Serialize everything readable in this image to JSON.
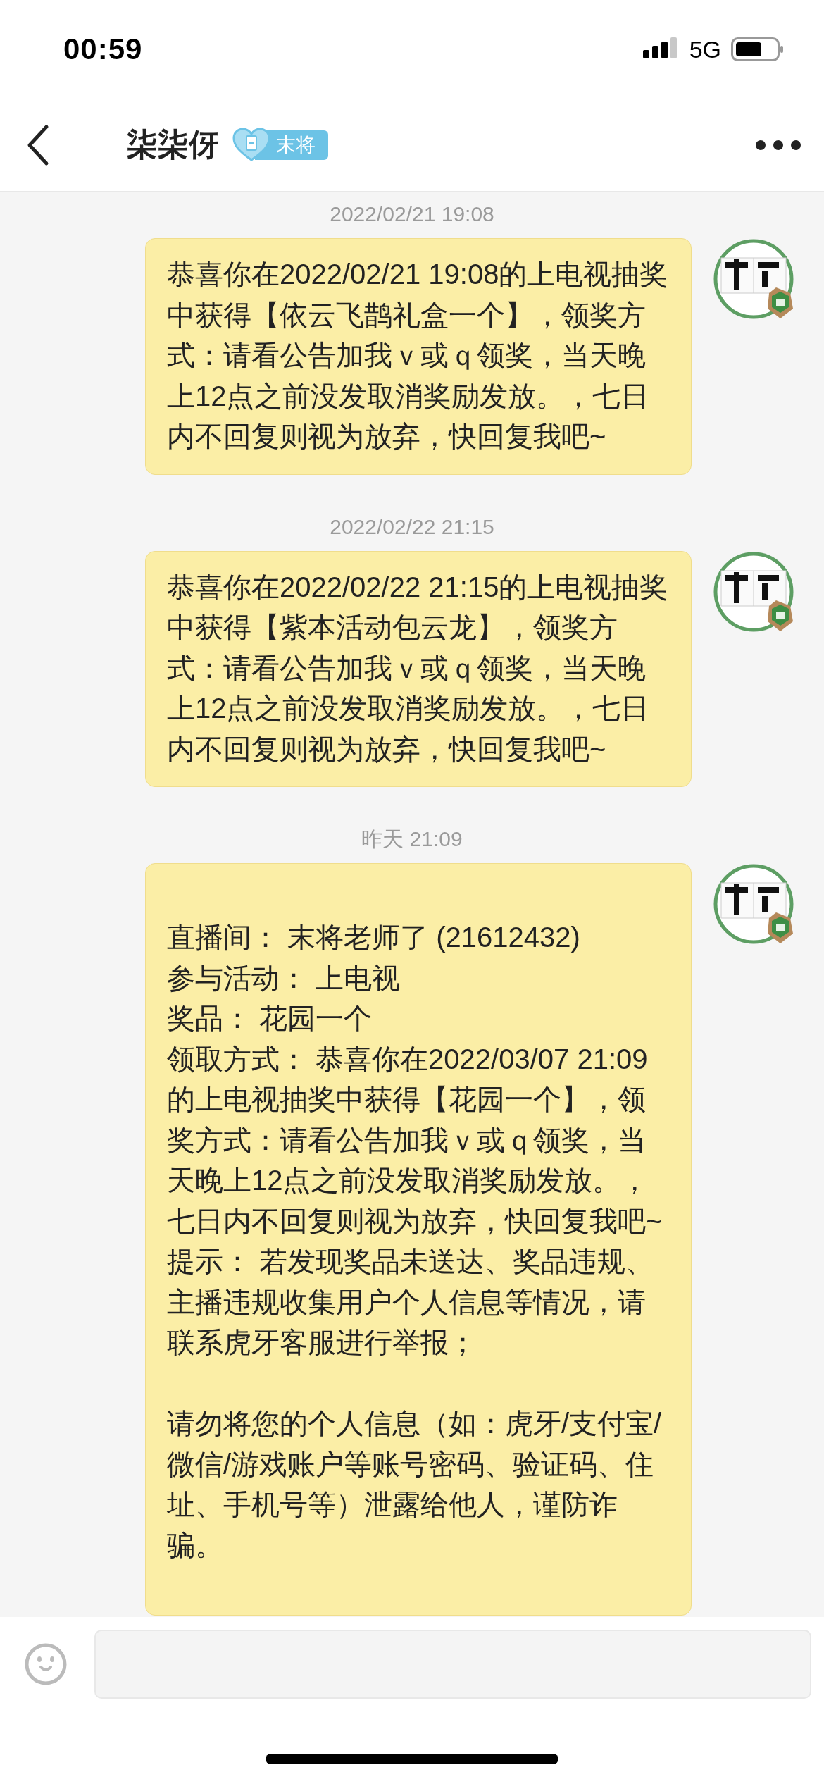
{
  "status_bar": {
    "time": "00:59",
    "network": "5G"
  },
  "header": {
    "title": "柒柒伢",
    "badge": "末将"
  },
  "messages": [
    {
      "timestamp": "2022/02/21 19:08",
      "kind": "text",
      "text": "恭喜你在2022/02/21 19:08的上电视抽奖中获得【依云飞鹊礼盒一个】，领奖方式：请看公告加我ｖ或ｑ领奖，当天晚上12点之前没发取消奖励发放。，七日内不回复则视为放弃，快回复我吧~"
    },
    {
      "timestamp": "2022/02/22 21:15",
      "kind": "text",
      "text": "恭喜你在2022/02/22 21:15的上电视抽奖中获得【紫本活动包云龙】，领奖方式：请看公告加我ｖ或ｑ领奖，当天晚上12点之前没发取消奖励发放。，七日内不回复则视为放弃，快回复我吧~"
    },
    {
      "timestamp": "昨天 21:09",
      "kind": "notice",
      "sections": [
        [
          "直播间： 末将老师了 (21612432)",
          "参与活动： 上电视",
          "奖品： 花园一个",
          "领取方式： 恭喜你在2022/03/07 21:09的上电视抽奖中获得【花园一个】，领奖方式：请看公告加我ｖ或ｑ领奖，当天晚上12点之前没发取消奖励发放。，七日内不回复则视为放弃，快回复我吧~",
          "提示： 若发现奖品未送达、奖品违规、主播违规收集用户个人信息等情况，请联系虎牙客服进行举报；"
        ],
        [
          "请勿将您的个人信息（如：虎牙/支付宝/微信/游戏账户等账号密码、验证码、住址、手机号等）泄露给他人，谨防诈骗。"
        ]
      ]
    }
  ]
}
